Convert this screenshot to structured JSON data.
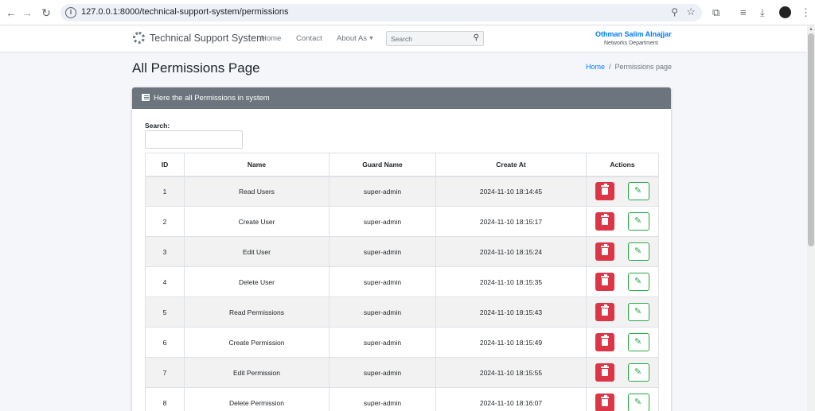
{
  "browser": {
    "url": "127.0.0.1:8000/technical-support-system/permissions",
    "icons": [
      "back-arrow-icon",
      "forward-arrow-icon",
      "reload-icon",
      "site-info-icon",
      "zoom-icon",
      "bookmark-star-icon",
      "extensions-icon",
      "reading-list-icon",
      "download-icon",
      "profile-avatar",
      "kebab-menu-icon"
    ]
  },
  "navbar": {
    "brand": "Technical Support System",
    "links": [
      "Home",
      "Contact",
      "About As"
    ],
    "search_placeholder": "Search",
    "user_name": "Othman Salim Alnajjar",
    "user_department": "Networks Department"
  },
  "page": {
    "title": "All Permissions Page",
    "breadcrumb_home": "Home",
    "breadcrumb_separator": "/",
    "breadcrumb_current": "Permissions page"
  },
  "card": {
    "title": "Here the all Permissions in system",
    "search_label": "Search:"
  },
  "table": {
    "headers": [
      "ID",
      "Name",
      "Guard Name",
      "Create At",
      "Actions"
    ],
    "rows": [
      {
        "id": "1",
        "name": "Read Users",
        "guard": "super-admin",
        "created": "2024-11-10 18:14:45"
      },
      {
        "id": "2",
        "name": "Create User",
        "guard": "super-admin",
        "created": "2024-11-10 18:15:17"
      },
      {
        "id": "3",
        "name": "Edit User",
        "guard": "super-admin",
        "created": "2024-11-10 18:15:24"
      },
      {
        "id": "4",
        "name": "Delete User",
        "guard": "super-admin",
        "created": "2024-11-10 18:15:35"
      },
      {
        "id": "5",
        "name": "Read Permissions",
        "guard": "super-admin",
        "created": "2024-11-10 18:15:43"
      },
      {
        "id": "6",
        "name": "Create Permission",
        "guard": "super-admin",
        "created": "2024-11-10 18:15:49"
      },
      {
        "id": "7",
        "name": "Edit Permission",
        "guard": "super-admin",
        "created": "2024-11-10 18:15:55"
      },
      {
        "id": "8",
        "name": "Delete Permission",
        "guard": "super-admin",
        "created": "2024-11-10 18:16:07"
      }
    ]
  },
  "colors": {
    "accent": "#007bff",
    "card_header": "#6c757d",
    "danger": "#dc3545",
    "success": "#28a745"
  }
}
